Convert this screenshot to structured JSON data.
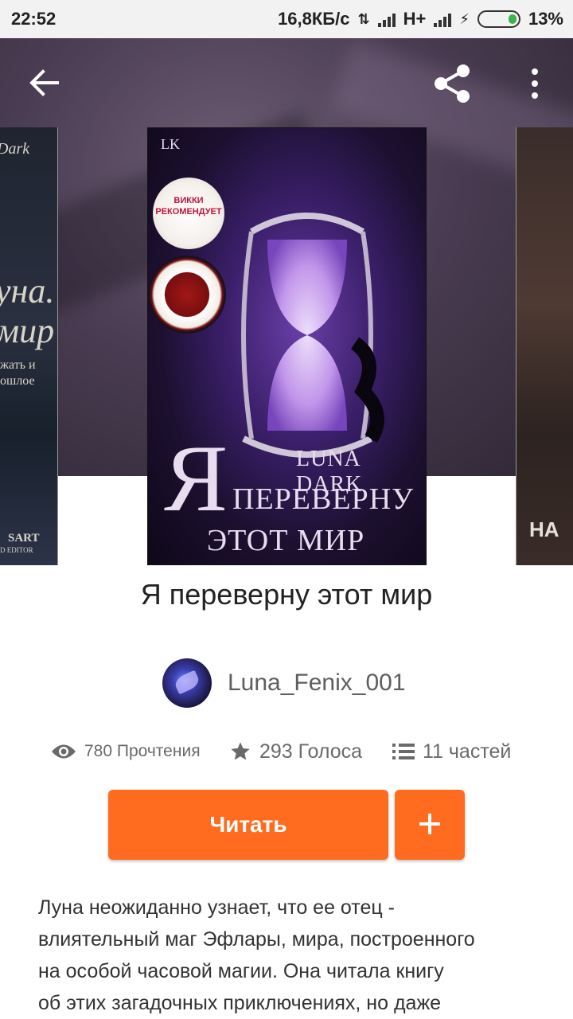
{
  "status_bar": {
    "time": "22:52",
    "network_speed": "16,8КБ/с",
    "network_type": "H+",
    "battery": "13%"
  },
  "colors": {
    "accent": "#ff6c1f",
    "hero_bg": "#4a3c52",
    "battery_fill": "#39b54a"
  },
  "header": {
    "back_icon": "arrow-left",
    "share_icon": "share",
    "menu_icon": "more-vertical"
  },
  "cover": {
    "badge_top": "ВИККИ РЕКОМЕНДУЕТ",
    "author": "LUNA DARK",
    "title_big_letter": "Я",
    "title_line1": "ПЕРЕВЕРНУ",
    "title_line2": "ЭТОТ МИР"
  },
  "cover_left": {
    "author": "Dark",
    "title1": "уна.",
    "title2": "мир",
    "subtitle1": "жать и",
    "subtitle2": "ошлое",
    "footer": "SART",
    "footer2": "D EDITOR"
  },
  "cover_right": {
    "text": "НА"
  },
  "book": {
    "title": "Я переверну этот мир",
    "author": "Luna_Fenix_001",
    "reads": "780 Прочтения",
    "votes": "293 Голоса",
    "parts": "11 частей",
    "description_lines": [
      "Луна неожиданно узнает, что ее отец -",
      "влиятельный маг Эфлары, мира, построенного",
      "на особой часовой магии. Она читала книгу",
      "об этих загадочных приключениях, но даже"
    ]
  },
  "actions": {
    "read_label": "Читать",
    "add_label": "+"
  }
}
